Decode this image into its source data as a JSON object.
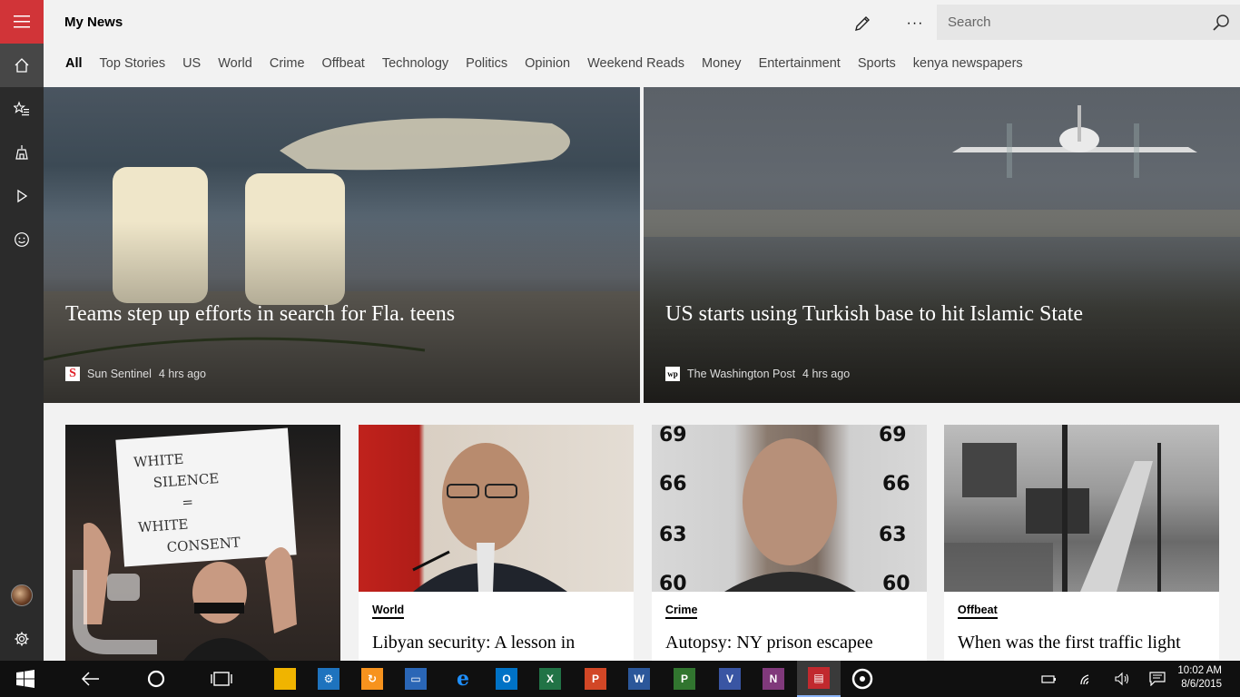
{
  "app": {
    "title": "My News"
  },
  "search": {
    "placeholder": "Search"
  },
  "tabs": [
    "All",
    "Top Stories",
    "US",
    "World",
    "Crime",
    "Offbeat",
    "Technology",
    "Politics",
    "Opinion",
    "Weekend Reads",
    "Money",
    "Entertainment",
    "Sports",
    "kenya newspapers"
  ],
  "active_tab": "All",
  "hero": [
    {
      "headline": "Teams step up efforts in search for Fla. teens",
      "source": "Sun Sentinel",
      "time": "4 hrs ago",
      "source_icon": "sun-sentinel-logo"
    },
    {
      "headline": "US starts using Turkish base to hit Islamic State",
      "source": "The Washington Post",
      "time": "4 hrs ago",
      "source_icon": "washington-post-logo"
    }
  ],
  "cards": [
    {
      "category": "",
      "title": "",
      "image": "protest-photo",
      "sign_text": [
        "WHITE",
        "SILENCE",
        "=",
        "WHITE",
        "CONSENT"
      ]
    },
    {
      "category": "World",
      "title": "Libyan security: A lesson in",
      "image": "libya-official-photo"
    },
    {
      "category": "Crime",
      "title": "Autopsy: NY prison escapee",
      "image": "mugshot-photo"
    },
    {
      "category": "Offbeat",
      "title": "When was the first traffic light",
      "image": "vintage-street-photo"
    }
  ],
  "taskbar": {
    "time": "10:02 AM",
    "date": "8/6/2015",
    "colors": {
      "accent": "#d13438",
      "rail": "#2b2b2b",
      "taskbar": "#101010"
    }
  }
}
